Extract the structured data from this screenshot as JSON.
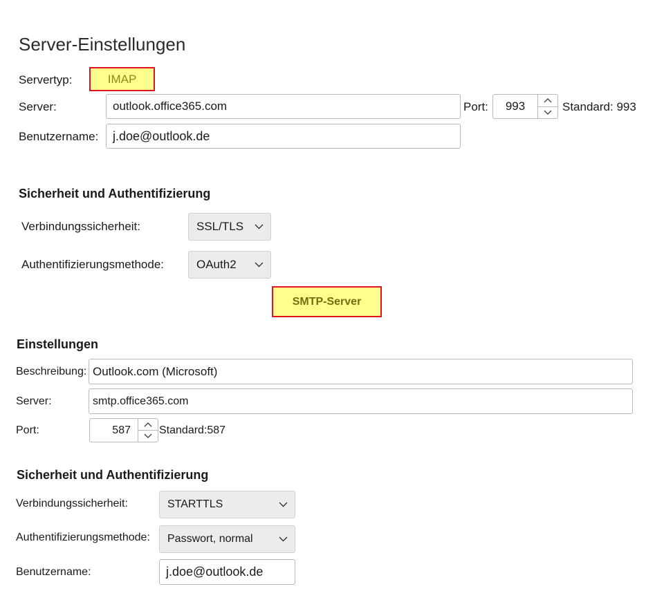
{
  "imap": {
    "title": "Server-Einstellungen",
    "servertype_label": "Servertyp:",
    "servertype_value": "IMAP",
    "server_label": "Server:",
    "server_value": "outlook.office365.com",
    "port_label": "Port:",
    "port_value": "993",
    "port_standard": "Standard: 993",
    "username_label": "Benutzername:",
    "username_value": "j.doe@outlook.de",
    "security_heading": "Sicherheit und Authentifizierung",
    "conn_security_label": "Verbindungssicherheit:",
    "conn_security_value": "SSL/TLS",
    "auth_label": "Authentifizierungsmethode:",
    "auth_value": "OAuth2"
  },
  "smtp": {
    "banner": "SMTP-Server",
    "settings_heading": "Einstellungen",
    "description_label": "Beschreibung:",
    "description_value": "Outlook.com (Microsoft)",
    "server_label": "Server:",
    "server_value": "smtp.office365.com",
    "port_label": "Port:",
    "port_value": "587",
    "port_standard": "Standard:587",
    "security_heading": "Sicherheit und Authentifizierung",
    "conn_security_label": "Verbindungssicherheit:",
    "conn_security_value": "STARTTLS",
    "auth_label": "Authentifizierungsmethode:",
    "auth_value": "Passwort, normal",
    "username_label": "Benutzername:",
    "username_value": "j.doe@outlook.de"
  },
  "icons": [
    "chevron-up-icon",
    "chevron-down-icon"
  ]
}
